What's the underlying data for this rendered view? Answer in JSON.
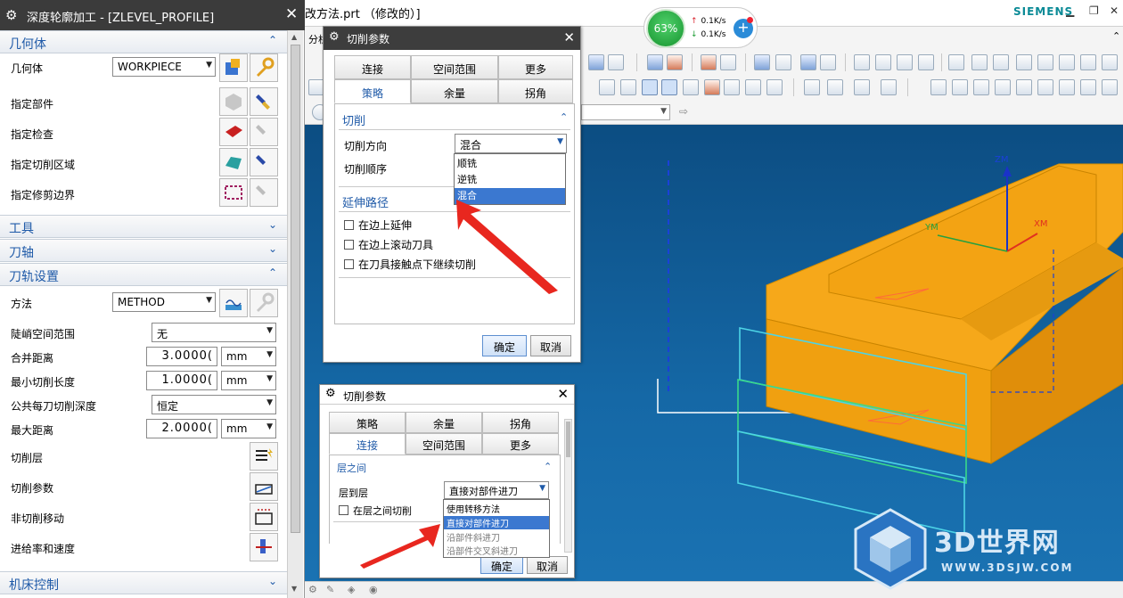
{
  "app": {
    "file_title": "改方法.prt （修改的）]",
    "brand": "SIEMENS"
  },
  "perf": {
    "cpu": "63%",
    "up": "0.1K/s",
    "down": "0.1K/s"
  },
  "toolbar": {
    "tab_label": "分析"
  },
  "left_panel": {
    "title": "深度轮廓加工 - [ZLEVEL_PROFILE]",
    "sections": {
      "geometry": "几何体",
      "tools": "工具",
      "tool_axis": "刀轴",
      "path_settings": "刀轨设置",
      "machine_control": "机床控制"
    },
    "geometry": {
      "geometry_label": "几何体",
      "geometry_value": "WORKPIECE",
      "part": "指定部件",
      "check": "指定检查",
      "cut_area": "指定切削区域",
      "trim": "指定修剪边界"
    },
    "path": {
      "method_label": "方法",
      "method_value": "METHOD",
      "steep_label": "陡峭空间范围",
      "steep_value": "无",
      "merge_label": "合并距离",
      "merge_value": "3.0000(",
      "merge_unit": "mm",
      "minlen_label": "最小切削长度",
      "minlen_value": "1.0000(",
      "minlen_unit": "mm",
      "depth_label": "公共每刀切削深度",
      "depth_value": "恒定",
      "maxdist_label": "最大距离",
      "maxdist_value": "2.0000(",
      "maxdist_unit": "mm",
      "layers": "切削层",
      "cut_params": "切削参数",
      "noncut": "非切削移动",
      "feeds": "进给率和速度"
    }
  },
  "dialog1": {
    "title": "切削参数",
    "tabs_row1": [
      "连接",
      "空间范围",
      "更多"
    ],
    "tabs_row2": [
      "策略",
      "余量",
      "拐角"
    ],
    "group_cut": "切削",
    "direction_label": "切削方向",
    "direction_value": "混合",
    "order_label": "切削顺序",
    "direction_options": [
      "顺铣",
      "逆铣",
      "混合"
    ],
    "group_extend": "延伸路径",
    "chk1": "在边上延伸",
    "chk2": "在边上滚动刀具",
    "chk3": "在刀具接触点下继续切削",
    "ok": "确定",
    "cancel": "取消"
  },
  "dialog2": {
    "title": "切削参数",
    "tabs_row1": [
      "策略",
      "余量",
      "拐角"
    ],
    "tabs_row2": [
      "连接",
      "空间范围",
      "更多"
    ],
    "group": "层之间",
    "layer_label": "层到层",
    "layer_value": "直接对部件进刀",
    "between_chk": "在层之间切削",
    "options": [
      "使用转移方法",
      "直接对部件进刀",
      "沿部件斜进刀",
      "沿部件交叉斜进刀"
    ],
    "ok": "确定",
    "cancel": "取消"
  },
  "viewport": {
    "axis_zm": "ZM",
    "axis_xm": "XM",
    "axis_ym": "YM"
  },
  "watermark": {
    "text": "3D世界网",
    "url": "WWW.3DSJW.COM"
  },
  "colors": {
    "accent": "#1f5aa8",
    "part": "#f2a30f",
    "viewport": "#1568a6"
  }
}
